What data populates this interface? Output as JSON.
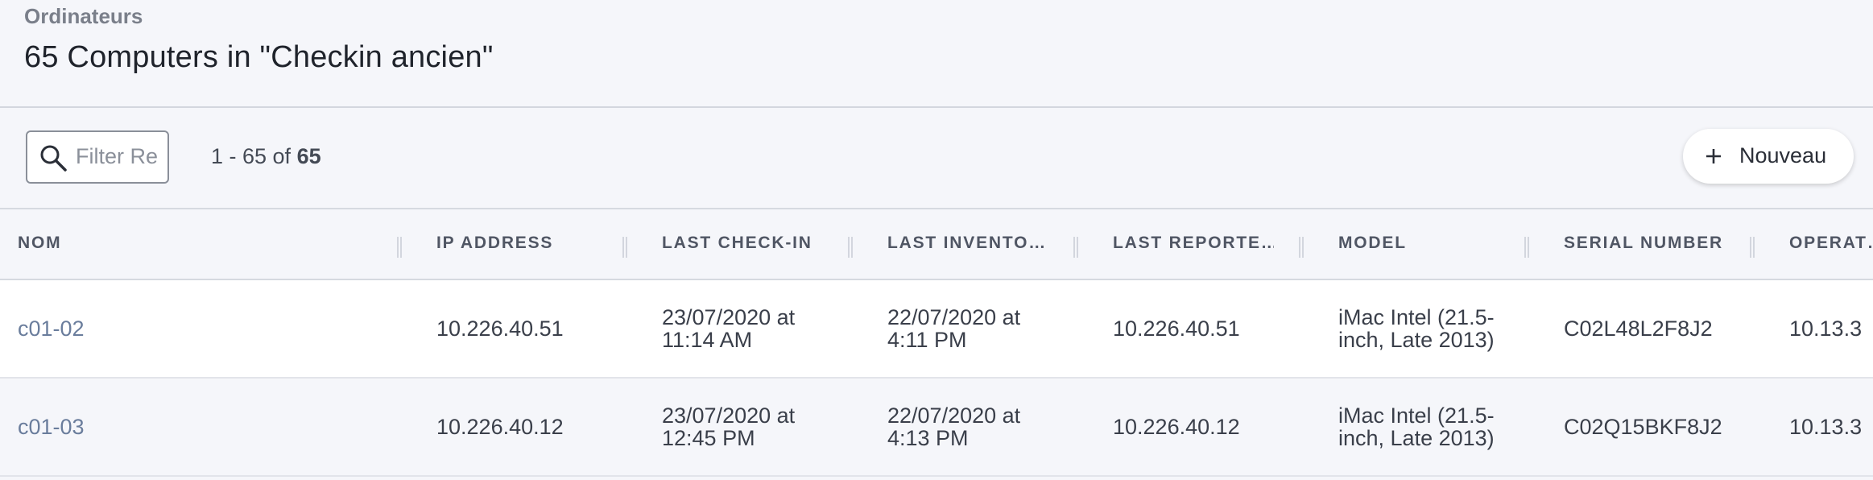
{
  "header": {
    "breadcrumb": "Ordinateurs",
    "title": "65 Computers in \"Checkin ancien\""
  },
  "toolbar": {
    "search_placeholder": "Filter Re",
    "pagination_range": "1 - 65 of ",
    "pagination_total": "65",
    "new_button_label": "Nouveau"
  },
  "table": {
    "columns": [
      "NOM",
      "IP ADDRESS",
      "LAST CHECK-IN",
      "LAST INVENTO…",
      "LAST REPORTE…",
      "MODEL",
      "SERIAL NUMBER",
      "OPERAT…"
    ],
    "rows": [
      {
        "name": "c01-02",
        "ip": "10.226.40.51",
        "checkin_date": "23/07/2020 at",
        "checkin_time": "11:14 AM",
        "inventory_date": "22/07/2020 at",
        "inventory_time": "4:11 PM",
        "reported_ip": "10.226.40.51",
        "model_line1": "iMac Intel (21.5-",
        "model_line2": "inch, Late 2013)",
        "serial": "C02L48L2F8J2",
        "os": "10.13.3"
      },
      {
        "name": "c01-03",
        "ip": "10.226.40.12",
        "checkin_date": "23/07/2020 at",
        "checkin_time": "12:45 PM",
        "inventory_date": "22/07/2020 at",
        "inventory_time": "4:13 PM",
        "reported_ip": "10.226.40.12",
        "model_line1": "iMac Intel (21.5-",
        "model_line2": "inch, Late 2013)",
        "serial": "C02Q15BKF8J2",
        "os": "10.13.3"
      }
    ]
  },
  "colors": {
    "link": "#6a7d9c",
    "background": "#f5f6fa",
    "row_white": "#ffffff"
  },
  "icons": {
    "search": "search-icon",
    "add": "plus-icon"
  }
}
